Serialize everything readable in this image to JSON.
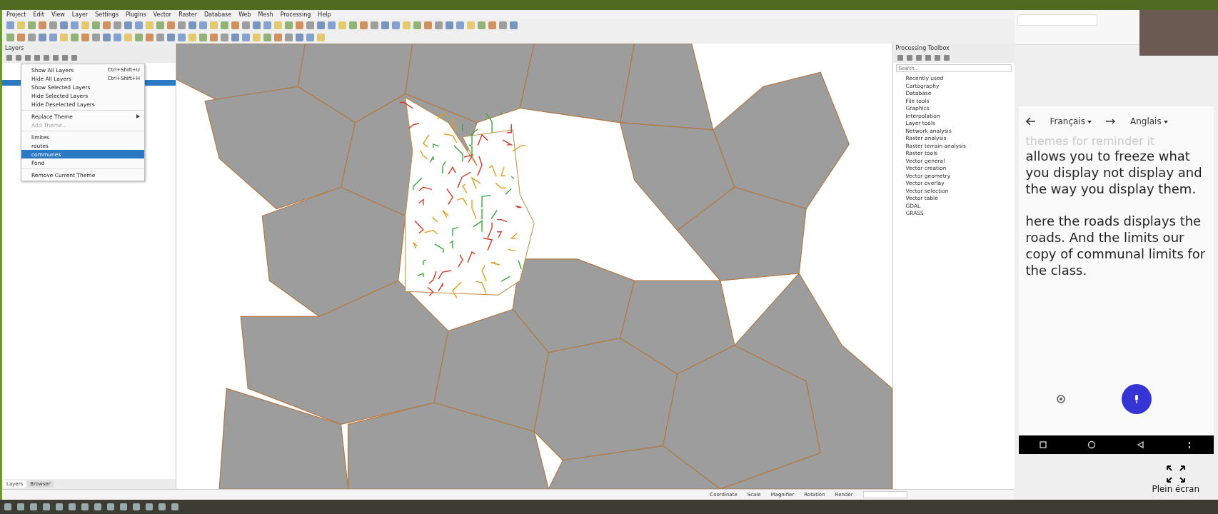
{
  "menu_bar": [
    "Project",
    "Edit",
    "View",
    "Layer",
    "Settings",
    "Plugins",
    "Vector",
    "Raster",
    "Database",
    "Web",
    "Mesh",
    "Processing",
    "Help"
  ],
  "layers_panel": {
    "title": "Layers",
    "tabs": [
      {
        "label": "Layers",
        "selected": true
      },
      {
        "label": "Browser",
        "selected": false
      }
    ]
  },
  "context_menu": [
    {
      "kind": "item",
      "label": "Show All Layers",
      "shortcut": "Ctrl+Shift+U",
      "disabled": false,
      "selected": false
    },
    {
      "kind": "item",
      "label": "Hide All Layers",
      "shortcut": "Ctrl+Shift+H",
      "disabled": false,
      "selected": false
    },
    {
      "kind": "item",
      "label": "Show Selected Layers",
      "disabled": false,
      "selected": false
    },
    {
      "kind": "item",
      "label": "Hide Selected Layers",
      "disabled": false,
      "selected": false
    },
    {
      "kind": "item",
      "label": "Hide Deselected Layers",
      "disabled": false,
      "selected": false
    },
    {
      "kind": "separator"
    },
    {
      "kind": "submenu",
      "label": "Replace Theme",
      "disabled": false,
      "selected": false
    },
    {
      "kind": "item",
      "label": "Add Theme…",
      "disabled": true,
      "selected": false
    },
    {
      "kind": "separator"
    },
    {
      "kind": "item",
      "label": "limites",
      "disabled": false,
      "selected": false
    },
    {
      "kind": "item",
      "label": "routes",
      "disabled": false,
      "selected": false
    },
    {
      "kind": "item",
      "label": "communes",
      "disabled": false,
      "selected": true
    },
    {
      "kind": "item",
      "label": "Fond",
      "disabled": false,
      "selected": false
    },
    {
      "kind": "separator"
    },
    {
      "kind": "item",
      "label": "Remove Current Theme",
      "disabled": false,
      "selected": false
    }
  ],
  "processing_toolbox": {
    "title": "Processing Toolbox",
    "search": {
      "placeholder": "Search..."
    },
    "groups": [
      "Recently used",
      "Cartography",
      "Database",
      "File tools",
      "Graphics",
      "Interpolation",
      "Layer tools",
      "Network analysis",
      "Raster analysis",
      "Raster terrain analysis",
      "Raster tools",
      "Vector general",
      "Vector creation",
      "Vector geometry",
      "Vector overlay",
      "Vector selection",
      "Vector table",
      "GDAL",
      "GRASS"
    ]
  },
  "status_bar": [
    "Coordinate",
    "Scale",
    "Magnifier",
    "Rotation",
    "Render"
  ],
  "translator": {
    "source_language": "Français",
    "target_language": "Anglais",
    "faded_text": "themes for reminder it",
    "paragraphs": [
      "allows you to freeze what you display not display and the way you display them.",
      "here the roads displays the roads. And the limits our copy of communal limits for the class."
    ],
    "fullscreen_label": "Plein écran"
  }
}
